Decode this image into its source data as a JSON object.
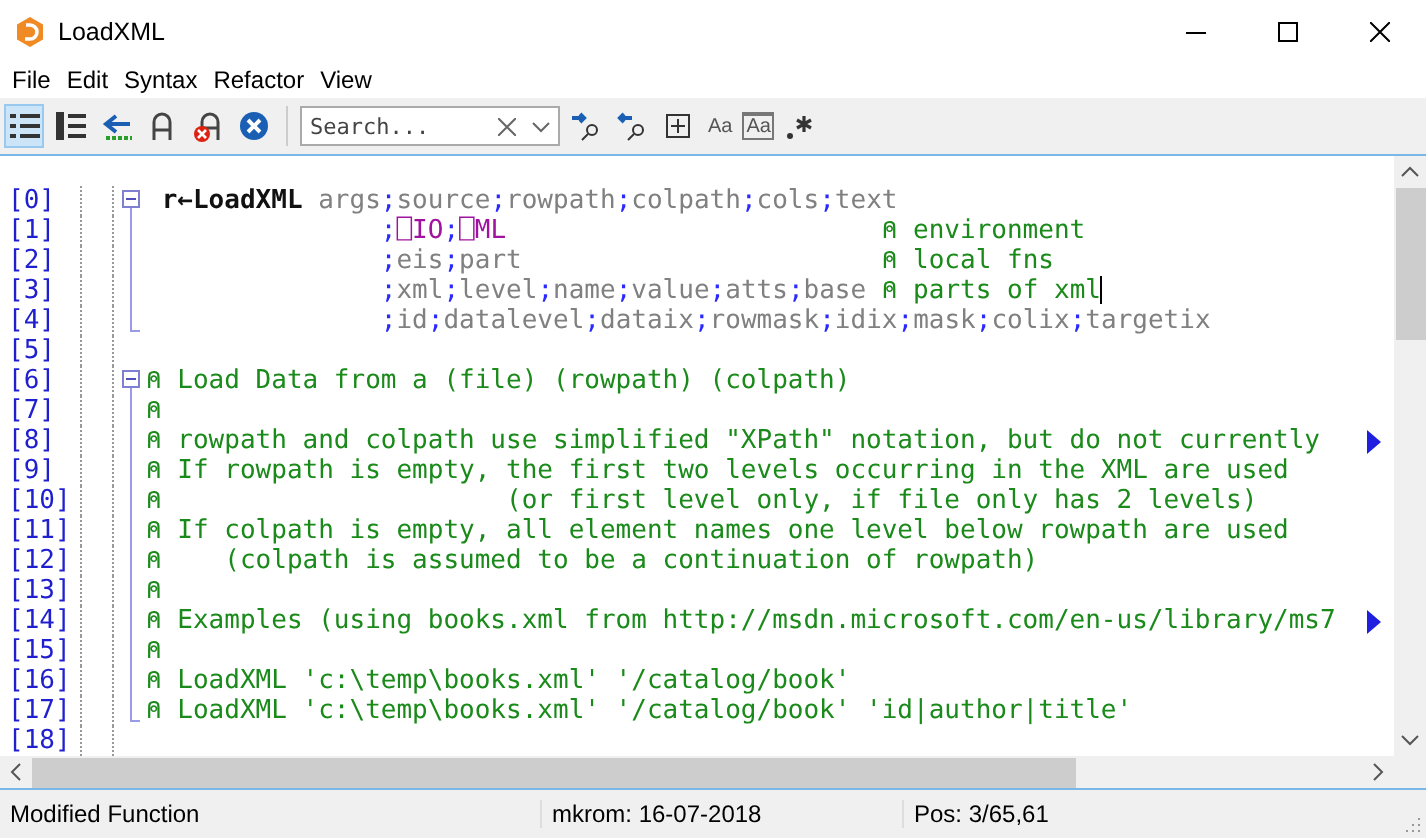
{
  "window": {
    "title": "LoadXML"
  },
  "menu": [
    "File",
    "Edit",
    "Syntax",
    "Refactor",
    "View"
  ],
  "toolbar": {
    "tools": [
      {
        "selected": true
      },
      {
        "selected": false
      },
      {
        "selected": false
      },
      {
        "selected": false
      },
      {
        "selected": false
      },
      {
        "selected": false
      }
    ],
    "search": {
      "placeholder": "Search..."
    },
    "search_options": [
      "Aa",
      "Aa"
    ]
  },
  "editor": {
    "lines": [
      {
        "number": "[0]",
        "kind": "fold-start",
        "expanded": true,
        "segments": [
          {
            "kind": "function",
            "text": " r←LoadXML "
          },
          {
            "kind": "name",
            "text": "args"
          },
          {
            "kind": "punct",
            "text": ";"
          },
          {
            "kind": "name",
            "text": "source"
          },
          {
            "kind": "punct",
            "text": ";"
          },
          {
            "kind": "name",
            "text": "rowpath"
          },
          {
            "kind": "punct",
            "text": ";"
          },
          {
            "kind": "name",
            "text": "colpath"
          },
          {
            "kind": "punct",
            "text": ";"
          },
          {
            "kind": "name",
            "text": "cols"
          },
          {
            "kind": "punct",
            "text": ";"
          },
          {
            "kind": "name",
            "text": "text"
          }
        ]
      },
      {
        "number": "[1]",
        "kind": "fold-middle",
        "segments": [
          {
            "kind": "punct",
            "text": "               ;"
          },
          {
            "kind": "system",
            "text": "⎕IO"
          },
          {
            "kind": "punct",
            "text": ";"
          },
          {
            "kind": "system",
            "text": "⎕ML"
          },
          {
            "kind": "comment",
            "text": "                        ⍝ environment"
          }
        ]
      },
      {
        "number": "[2]",
        "kind": "fold-middle",
        "segments": [
          {
            "kind": "punct",
            "text": "               ;"
          },
          {
            "kind": "name",
            "text": "eis"
          },
          {
            "kind": "punct",
            "text": ";"
          },
          {
            "kind": "name",
            "text": "part"
          },
          {
            "kind": "comment",
            "text": "                       ⍝ local fns"
          }
        ]
      },
      {
        "number": "[3]",
        "kind": "fold-middle",
        "caret": true,
        "segments": [
          {
            "kind": "punct",
            "text": "               ;"
          },
          {
            "kind": "name",
            "text": "xml"
          },
          {
            "kind": "punct",
            "text": ";"
          },
          {
            "kind": "name",
            "text": "level"
          },
          {
            "kind": "punct",
            "text": ";"
          },
          {
            "kind": "name",
            "text": "name"
          },
          {
            "kind": "punct",
            "text": ";"
          },
          {
            "kind": "name",
            "text": "value"
          },
          {
            "kind": "punct",
            "text": ";"
          },
          {
            "kind": "name",
            "text": "atts"
          },
          {
            "kind": "punct",
            "text": ";"
          },
          {
            "kind": "name",
            "text": "base"
          },
          {
            "kind": "comment",
            "text": " ⍝ parts of xml"
          }
        ]
      },
      {
        "number": "[4]",
        "kind": "fold-end",
        "segments": [
          {
            "kind": "punct",
            "text": "               ;"
          },
          {
            "kind": "name",
            "text": "id"
          },
          {
            "kind": "punct",
            "text": ";"
          },
          {
            "kind": "name",
            "text": "datalevel"
          },
          {
            "kind": "punct",
            "text": ";"
          },
          {
            "kind": "name",
            "text": "dataix"
          },
          {
            "kind": "punct",
            "text": ";"
          },
          {
            "kind": "name",
            "text": "rowmask"
          },
          {
            "kind": "punct",
            "text": ";"
          },
          {
            "kind": "name",
            "text": "idix"
          },
          {
            "kind": "punct",
            "text": ";"
          },
          {
            "kind": "name",
            "text": "mask"
          },
          {
            "kind": "punct",
            "text": ";"
          },
          {
            "kind": "name",
            "text": "colix"
          },
          {
            "kind": "punct",
            "text": ";"
          },
          {
            "kind": "name",
            "text": "targetix"
          }
        ]
      },
      {
        "number": "[5]",
        "kind": "plain"
      },
      {
        "number": "[6]",
        "kind": "fold-start",
        "expanded": true,
        "segments": [
          {
            "kind": "comment",
            "text": "⍝ Load Data from a (file) (rowpath) (colpath)"
          }
        ]
      },
      {
        "number": "[7]",
        "kind": "fold-middle",
        "segments": [
          {
            "kind": "comment",
            "text": "⍝"
          }
        ]
      },
      {
        "number": "[8]",
        "kind": "fold-middle",
        "overflow": true,
        "segments": [
          {
            "kind": "comment",
            "text": "⍝ rowpath and colpath use simplified \"XPath\" notation, but do not currently"
          }
        ]
      },
      {
        "number": "[9]",
        "kind": "fold-middle",
        "segments": [
          {
            "kind": "comment",
            "text": "⍝ If rowpath is empty, the first two levels occurring in the XML are used"
          }
        ]
      },
      {
        "number": "[10]",
        "kind": "fold-middle",
        "segments": [
          {
            "kind": "comment",
            "text": "⍝                      (or first level only, if file only has 2 levels)"
          }
        ]
      },
      {
        "number": "[11]",
        "kind": "fold-middle",
        "segments": [
          {
            "kind": "comment",
            "text": "⍝ If colpath is empty, all element names one level below rowpath are used"
          }
        ]
      },
      {
        "number": "[12]",
        "kind": "fold-middle",
        "segments": [
          {
            "kind": "comment",
            "text": "⍝    (colpath is assumed to be a continuation of rowpath)"
          }
        ]
      },
      {
        "number": "[13]",
        "kind": "fold-middle",
        "segments": [
          {
            "kind": "comment",
            "text": "⍝"
          }
        ]
      },
      {
        "number": "[14]",
        "kind": "fold-middle",
        "overflow": true,
        "segments": [
          {
            "kind": "comment",
            "text": "⍝ Examples (using books.xml from http://msdn.microsoft.com/en-us/library/ms7"
          }
        ]
      },
      {
        "number": "[15]",
        "kind": "fold-middle",
        "segments": [
          {
            "kind": "comment",
            "text": "⍝"
          }
        ]
      },
      {
        "number": "[16]",
        "kind": "fold-middle",
        "segments": [
          {
            "kind": "comment",
            "text": "⍝ LoadXML 'c:\\temp\\books.xml' '/catalog/book'"
          }
        ]
      },
      {
        "number": "[17]",
        "kind": "fold-end",
        "segments": [
          {
            "kind": "comment",
            "text": "⍝ LoadXML 'c:\\temp\\books.xml' '/catalog/book' 'id|author|title'"
          }
        ]
      },
      {
        "number": "[18]",
        "kind": "plain"
      }
    ]
  },
  "status_bar": [
    "Modified Function",
    "mkrom: 16-07-2018",
    "Pos: 3/65,61"
  ]
}
